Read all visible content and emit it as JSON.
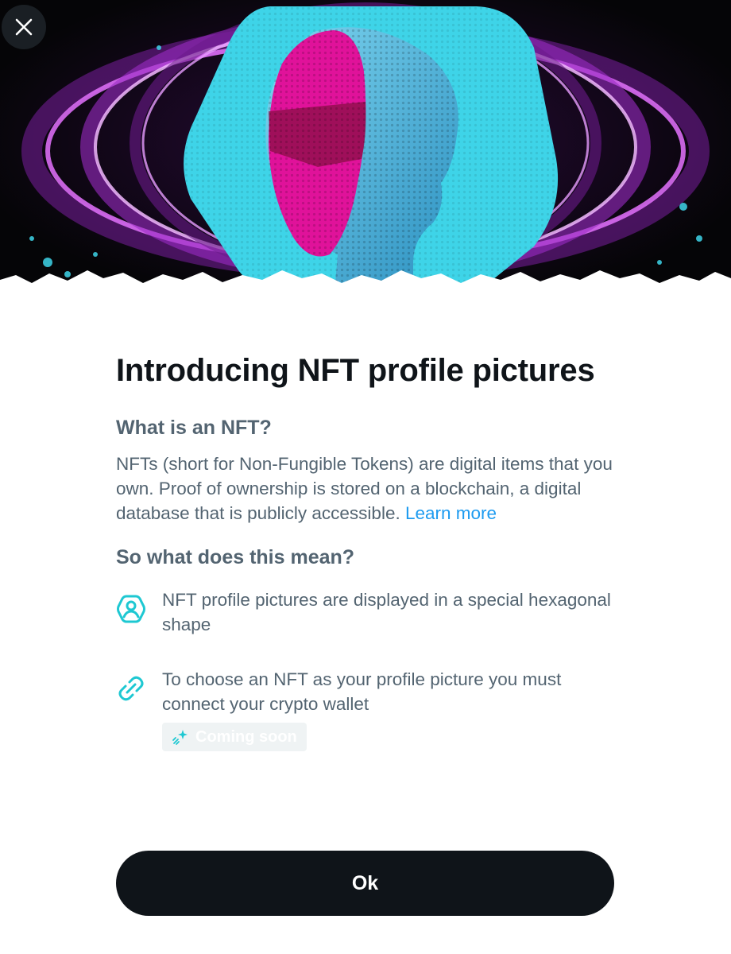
{
  "modal": {
    "title": "Introducing NFT profile pictures",
    "section_1": {
      "heading": "What is an NFT?",
      "body": "NFTs (short for Non-Fungible Tokens) are digital items that you own. Proof of ownership is stored on a blockchain, a digital database that is publicly accessible.",
      "link_label": "Learn more"
    },
    "section_2": {
      "heading": "So what does this mean?",
      "features": [
        {
          "icon": "hexagon-avatar-icon",
          "text": "NFT profile pictures are displayed in a special hexagonal shape"
        },
        {
          "icon": "link-chain-icon",
          "text": "To choose an NFT as your profile picture you must connect your crypto wallet",
          "badge": {
            "icon": "sparkle-icon",
            "label": "Coming soon"
          }
        }
      ]
    },
    "ok_label": "Ok",
    "close_label": "Close"
  },
  "colors": {
    "accent_teal": "#1ec8d2",
    "link_blue": "#1d9bf0",
    "body_gray": "#536471",
    "button_black": "#0f1419",
    "hero_magenta": "#e0129a",
    "hero_cyan": "#3ed4e8"
  }
}
